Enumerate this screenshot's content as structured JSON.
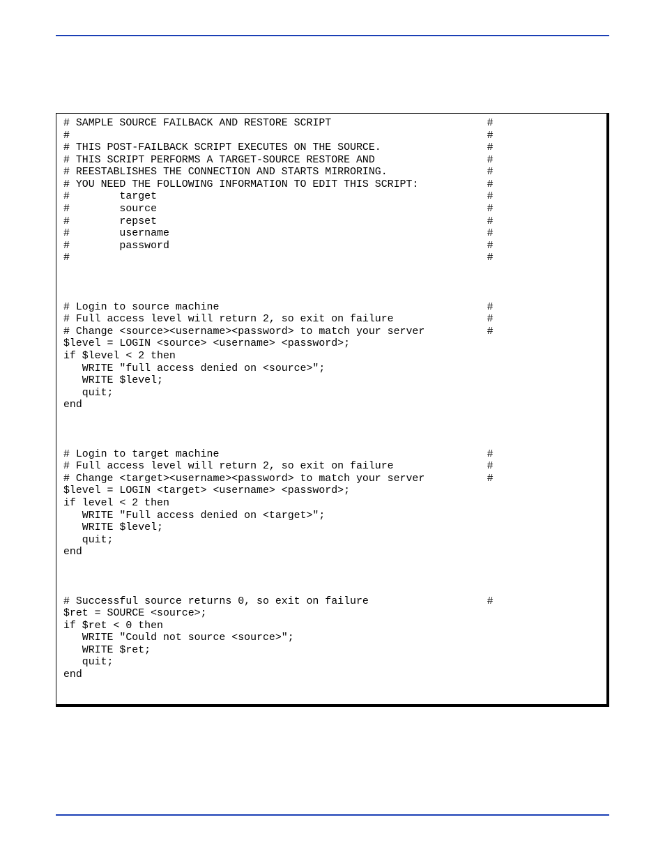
{
  "code": "# SAMPLE SOURCE FAILBACK AND RESTORE SCRIPT                         #\n#                                                                   #\n# THIS POST-FAILBACK SCRIPT EXECUTES ON THE SOURCE.                 #\n# THIS SCRIPT PERFORMS A TARGET-SOURCE RESTORE AND                  #\n# REESTABLISHES THE CONNECTION AND STARTS MIRRORING.                #\n# YOU NEED THE FOLLOWING INFORMATION TO EDIT THIS SCRIPT:           #\n#        target                                                     #\n#        source                                                     #\n#        repset                                                     #\n#        username                                                   #\n#        password                                                   #\n#                                                                   #\n\n\n\n# Login to source machine                                           #\n# Full access level will return 2, so exit on failure               #\n# Change <source><username><password> to match your server          #\n$level = LOGIN <source> <username> <password>;\nif $level < 2 then\n   WRITE \"full access denied on <source>\";\n   WRITE $level;\n   quit;\nend\n\n\n\n# Login to target machine                                           #\n# Full access level will return 2, so exit on failure               #\n# Change <target><username><password> to match your server          #\n$level = LOGIN <target> <username> <password>;\nif level < 2 then\n   WRITE \"Full access denied on <target>\";\n   WRITE $level;\n   quit;\nend\n\n\n\n# Successful source returns 0, so exit on failure                   #\n$ret = SOURCE <source>;\nif $ret < 0 then\n   WRITE \"Could not source <source>\";\n   WRITE $ret;\n   quit;\nend"
}
